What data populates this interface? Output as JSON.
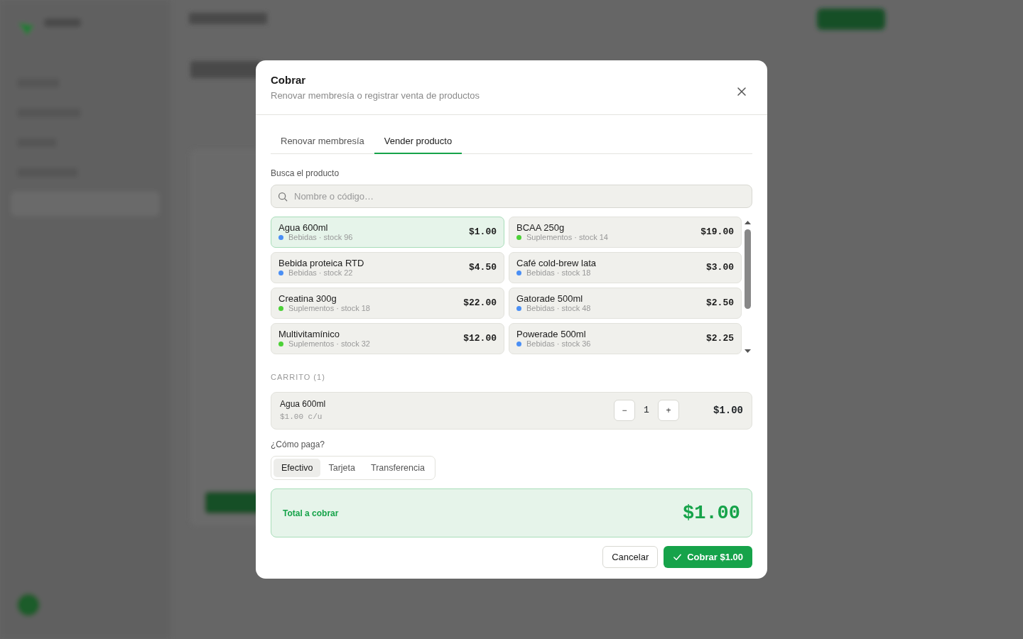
{
  "dialog": {
    "title": "Cobrar",
    "subtitle": "Renovar membresía o registrar venta de productos"
  },
  "tabs": [
    {
      "label": "Renovar membresía",
      "selected": false
    },
    {
      "label": "Vender producto",
      "selected": true
    }
  ],
  "search": {
    "label": "Busca el producto",
    "placeholder": "Nombre o código…"
  },
  "products": [
    {
      "name": "Agua 600ml",
      "meta": "Bebidas · stock 96",
      "price": "$1.00",
      "color": "#4a8ff5",
      "selected": true
    },
    {
      "name": "BCAA 250g",
      "meta": "Suplementos · stock 14",
      "price": "$19.00",
      "color": "#4cd137",
      "selected": false
    },
    {
      "name": "Bebida proteica RTD",
      "meta": "Bebidas · stock 22",
      "price": "$4.50",
      "color": "#4a8ff5",
      "selected": false
    },
    {
      "name": "Café cold-brew lata",
      "meta": "Bebidas · stock 18",
      "price": "$3.00",
      "color": "#4a8ff5",
      "selected": false
    },
    {
      "name": "Creatina 300g",
      "meta": "Suplementos · stock 18",
      "price": "$22.00",
      "color": "#4cd137",
      "selected": false
    },
    {
      "name": "Gatorade 500ml",
      "meta": "Bebidas · stock 48",
      "price": "$2.50",
      "color": "#4a8ff5",
      "selected": false
    },
    {
      "name": "Multivitamínico",
      "meta": "Suplementos · stock 32",
      "price": "$12.00",
      "color": "#4cd137",
      "selected": false
    },
    {
      "name": "Powerade 500ml",
      "meta": "Bebidas · stock 36",
      "price": "$2.25",
      "color": "#4a8ff5",
      "selected": false
    }
  ],
  "cart": {
    "heading": "CARRITO (1)",
    "items": [
      {
        "name": "Agua 600ml",
        "unit_price": "$1.00 c/u",
        "minus": "−",
        "quantity": "1",
        "plus": "+",
        "total": "$1.00"
      }
    ]
  },
  "payment": {
    "label": "¿Cómo paga?",
    "options": [
      {
        "label": "Efectivo",
        "selected": true
      },
      {
        "label": "Tarjeta",
        "selected": false
      },
      {
        "label": "Transferencia",
        "selected": false
      }
    ]
  },
  "total": {
    "label": "Total a cobrar",
    "amount": "$1.00"
  },
  "buttons": {
    "cancel": "Cancelar",
    "confirm": "Cobrar $1.00"
  }
}
